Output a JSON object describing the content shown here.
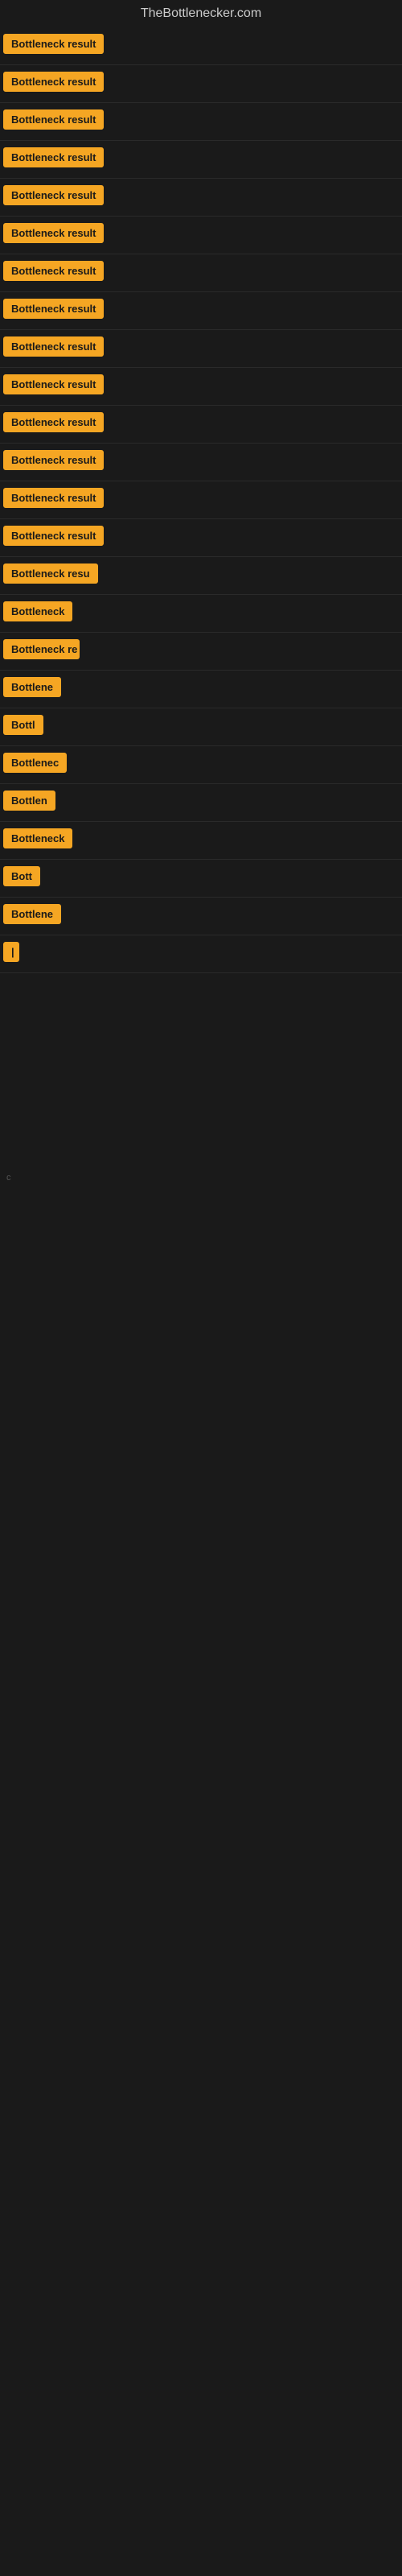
{
  "site": {
    "title": "TheBottlenecker.com"
  },
  "rows": [
    {
      "id": 1,
      "label": "Bottleneck result",
      "width_class": "badge-full"
    },
    {
      "id": 2,
      "label": "Bottleneck result",
      "width_class": "badge-full"
    },
    {
      "id": 3,
      "label": "Bottleneck result",
      "width_class": "badge-full"
    },
    {
      "id": 4,
      "label": "Bottleneck result",
      "width_class": "badge-full"
    },
    {
      "id": 5,
      "label": "Bottleneck result",
      "width_class": "badge-full"
    },
    {
      "id": 6,
      "label": "Bottleneck result",
      "width_class": "badge-full"
    },
    {
      "id": 7,
      "label": "Bottleneck result",
      "width_class": "badge-full"
    },
    {
      "id": 8,
      "label": "Bottleneck result",
      "width_class": "badge-full"
    },
    {
      "id": 9,
      "label": "Bottleneck result",
      "width_class": "badge-full"
    },
    {
      "id": 10,
      "label": "Bottleneck result",
      "width_class": "badge-full"
    },
    {
      "id": 11,
      "label": "Bottleneck result",
      "width_class": "badge-full"
    },
    {
      "id": 12,
      "label": "Bottleneck result",
      "width_class": "badge-full"
    },
    {
      "id": 13,
      "label": "Bottleneck result",
      "width_class": "badge-full"
    },
    {
      "id": 14,
      "label": "Bottleneck result",
      "width_class": "badge-full"
    },
    {
      "id": 15,
      "label": "Bottleneck resu",
      "width_class": "badge-w1"
    },
    {
      "id": 16,
      "label": "Bottleneck",
      "width_class": "badge-w2"
    },
    {
      "id": 17,
      "label": "Bottleneck re",
      "width_class": "badge-w3"
    },
    {
      "id": 18,
      "label": "Bottlene",
      "width_class": "badge-w4"
    },
    {
      "id": 19,
      "label": "Bottl",
      "width_class": "badge-w5"
    },
    {
      "id": 20,
      "label": "Bottlenec",
      "width_class": "badge-w4"
    },
    {
      "id": 21,
      "label": "Bottlen",
      "width_class": "badge-w3"
    },
    {
      "id": 22,
      "label": "Bottleneck",
      "width_class": "badge-w2"
    },
    {
      "id": 23,
      "label": "Bott",
      "width_class": "badge-w6"
    },
    {
      "id": 24,
      "label": "Bottlene",
      "width_class": "badge-w4"
    },
    {
      "id": 25,
      "label": "|",
      "width_class": "badge-tiny"
    }
  ],
  "colors": {
    "badge_bg": "#f5a623",
    "badge_text": "#1a1a1a",
    "bg": "#1a1a1a",
    "title": "#cccccc"
  }
}
